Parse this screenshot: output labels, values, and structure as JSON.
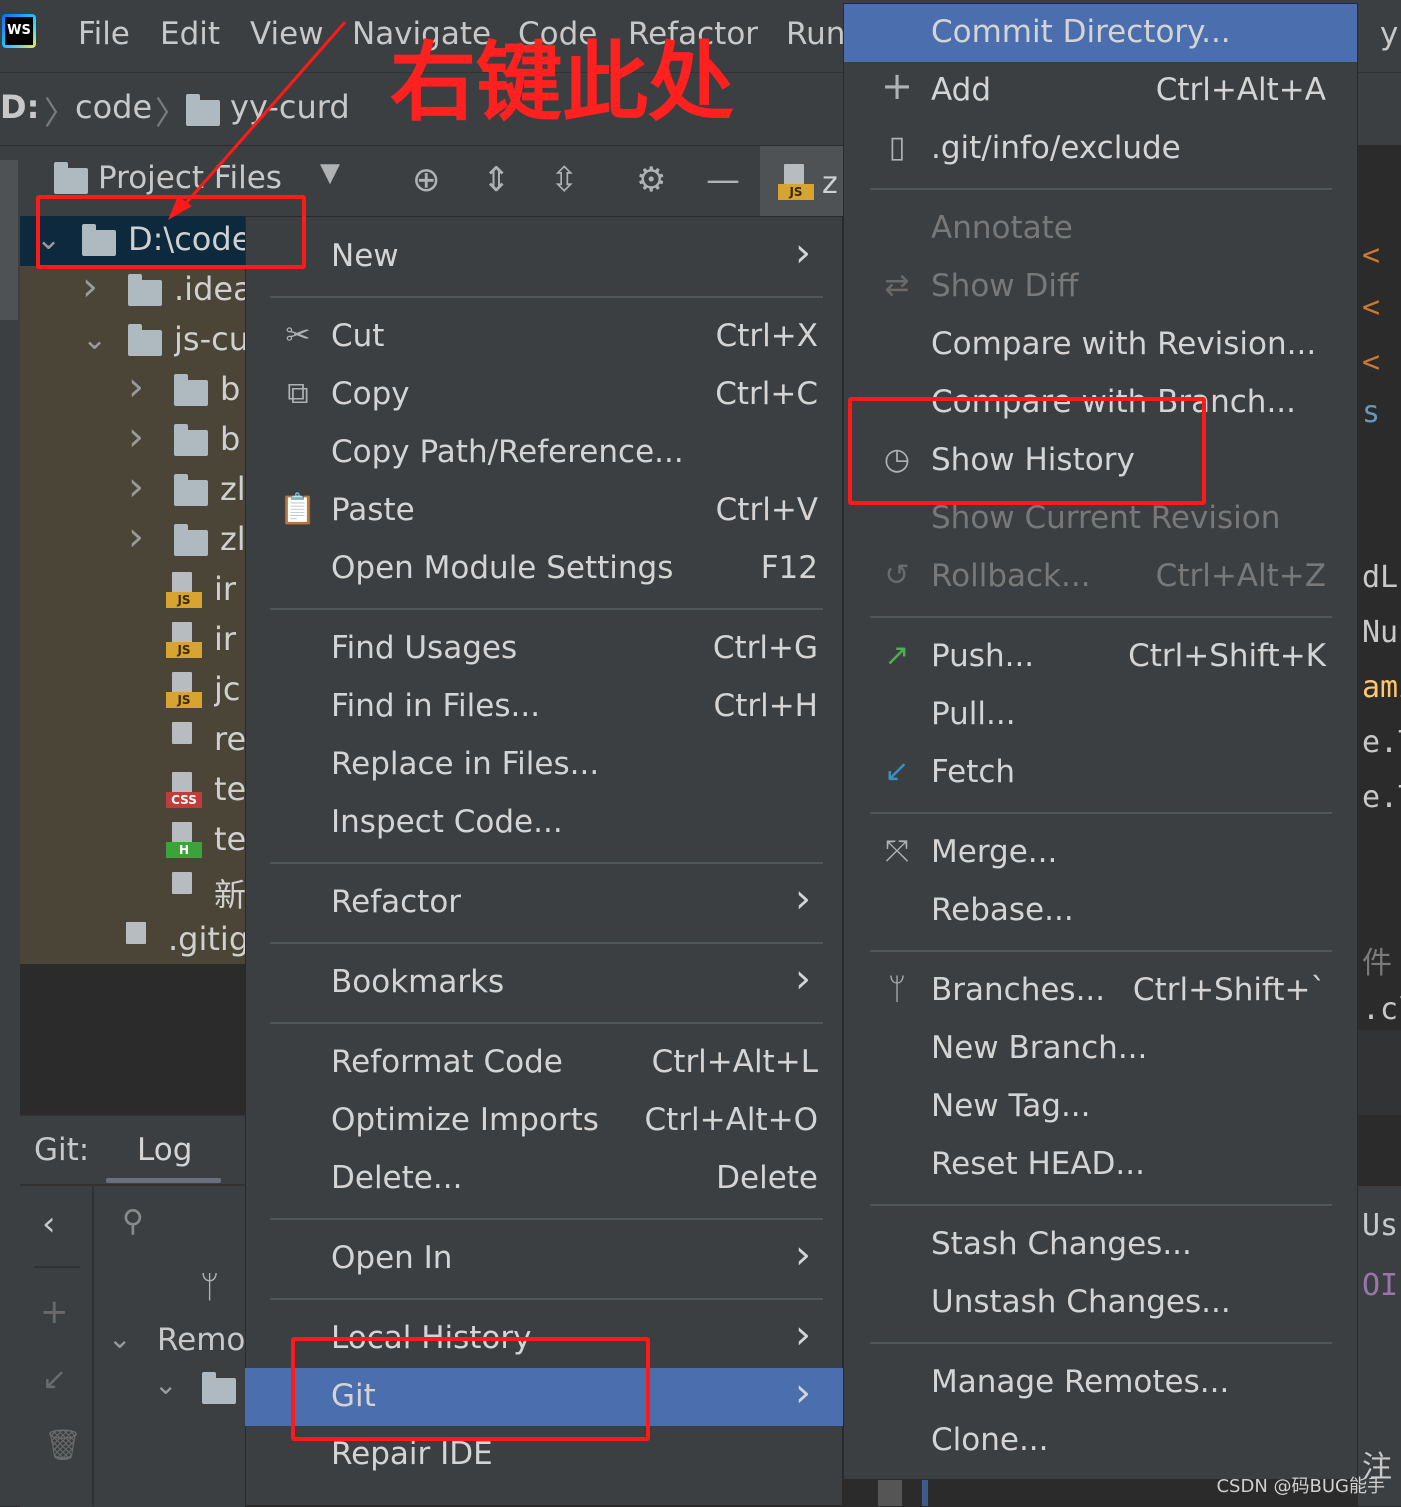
{
  "app": {
    "logo_text": "WS"
  },
  "menubar": [
    "File",
    "Edit",
    "View",
    "Navigate",
    "Code",
    "Refactor",
    "Run"
  ],
  "menubar_right_fragment": "y",
  "breadcrumb": [
    "D:",
    "code",
    "yy-curd"
  ],
  "annotation_text": "右键此处",
  "project_panel": {
    "title": "Project Files",
    "editor_tab_fragment": "z"
  },
  "tree": [
    {
      "label": "D:\\code",
      "depth": 0,
      "type": "folder",
      "expanded": true,
      "selected": true
    },
    {
      "label": ".idea",
      "depth": 1,
      "type": "folder",
      "expanded": false
    },
    {
      "label": "js-cu",
      "depth": 1,
      "type": "folder",
      "expanded": true
    },
    {
      "label": "b",
      "depth": 2,
      "type": "folder",
      "expanded": false
    },
    {
      "label": "b",
      "depth": 2,
      "type": "folder",
      "expanded": false
    },
    {
      "label": "zl",
      "depth": 2,
      "type": "folder",
      "expanded": false
    },
    {
      "label": "zl",
      "depth": 2,
      "type": "folder",
      "expanded": false
    },
    {
      "label": "ir",
      "depth": 2,
      "type": "js"
    },
    {
      "label": "ir",
      "depth": 2,
      "type": "js"
    },
    {
      "label": "jc",
      "depth": 2,
      "type": "json"
    },
    {
      "label": "re",
      "depth": 2,
      "type": "text"
    },
    {
      "label": "te",
      "depth": 2,
      "type": "css"
    },
    {
      "label": "te",
      "depth": 2,
      "type": "html"
    },
    {
      "label": "新",
      "depth": 2,
      "type": "text"
    },
    {
      "label": ".gitig",
      "depth": 1,
      "type": "gitignore"
    }
  ],
  "git_panel": {
    "label": "Git:",
    "tab": "Log",
    "remote_label": "Remo"
  },
  "context_menu": [
    {
      "label": "New",
      "submenu": true
    },
    {
      "sep": true
    },
    {
      "label": "Cut",
      "shortcut": "Ctrl+X",
      "icon": "scissors-icon"
    },
    {
      "label": "Copy",
      "shortcut": "Ctrl+C",
      "icon": "copy-icon"
    },
    {
      "label": "Copy Path/Reference..."
    },
    {
      "label": "Paste",
      "shortcut": "Ctrl+V",
      "icon": "clipboard-icon"
    },
    {
      "label": "Open Module Settings",
      "shortcut": "F12"
    },
    {
      "sep": true
    },
    {
      "label": "Find Usages",
      "shortcut": "Ctrl+G"
    },
    {
      "label": "Find in Files...",
      "shortcut": "Ctrl+H"
    },
    {
      "label": "Replace in Files..."
    },
    {
      "label": "Inspect Code..."
    },
    {
      "sep": true
    },
    {
      "label": "Refactor",
      "submenu": true
    },
    {
      "sep": true
    },
    {
      "label": "Bookmarks",
      "submenu": true
    },
    {
      "sep": true
    },
    {
      "label": "Reformat Code",
      "shortcut": "Ctrl+Alt+L"
    },
    {
      "label": "Optimize Imports",
      "shortcut": "Ctrl+Alt+O"
    },
    {
      "label": "Delete...",
      "shortcut": "Delete"
    },
    {
      "sep": true
    },
    {
      "label": "Open In",
      "submenu": true
    },
    {
      "sep": true
    },
    {
      "label": "Local History",
      "submenu": true
    },
    {
      "label": "Git",
      "submenu": true,
      "highlighted": true
    },
    {
      "label": "Repair IDE"
    }
  ],
  "git_submenu": [
    {
      "label": "Commit Directory...",
      "highlighted": true
    },
    {
      "label": "Add",
      "shortcut": "Ctrl+Alt+A",
      "icon": "plus-icon"
    },
    {
      "label": ".git/info/exclude",
      "icon": "gitignore-file-icon"
    },
    {
      "sep": true
    },
    {
      "label": "Annotate",
      "disabled": true
    },
    {
      "label": "Show Diff",
      "disabled": true,
      "icon": "diff-arrows-icon"
    },
    {
      "label": "Compare with Revision..."
    },
    {
      "label": "Compare with Branch..."
    },
    {
      "label": "Show History",
      "icon": "clock-icon"
    },
    {
      "label": "Show Current Revision",
      "disabled": true
    },
    {
      "label": "Rollback...",
      "shortcut": "Ctrl+Alt+Z",
      "disabled": true,
      "icon": "rollback-icon"
    },
    {
      "sep": true
    },
    {
      "label": "Push...",
      "shortcut": "Ctrl+Shift+K",
      "icon": "push-arrow-icon"
    },
    {
      "label": "Pull..."
    },
    {
      "label": "Fetch",
      "icon": "fetch-arrow-icon"
    },
    {
      "sep": true
    },
    {
      "label": "Merge...",
      "icon": "merge-icon"
    },
    {
      "label": "Rebase..."
    },
    {
      "sep": true
    },
    {
      "label": "Branches...",
      "shortcut": "Ctrl+Shift+`",
      "icon": "branch-icon"
    },
    {
      "label": "New Branch..."
    },
    {
      "label": "New Tag..."
    },
    {
      "label": "Reset HEAD..."
    },
    {
      "sep": true
    },
    {
      "label": "Stash Changes..."
    },
    {
      "label": "Unstash Changes..."
    },
    {
      "sep": true
    },
    {
      "label": "Manage Remotes..."
    },
    {
      "label": "Clone..."
    }
  ],
  "editor_fragments": [
    "<",
    "<",
    "<",
    "s",
    "dL",
    "Nun",
    "ami",
    "e.T",
    "e.T",
    "件",
    ".cl",
    "Us",
    "OI",
    "注"
  ],
  "watermark": "CSDN @码BUG能手",
  "colors": {
    "highlight": "#4b6eaf",
    "annotation_red": "#ff1a1a",
    "background": "#3c3f41"
  }
}
